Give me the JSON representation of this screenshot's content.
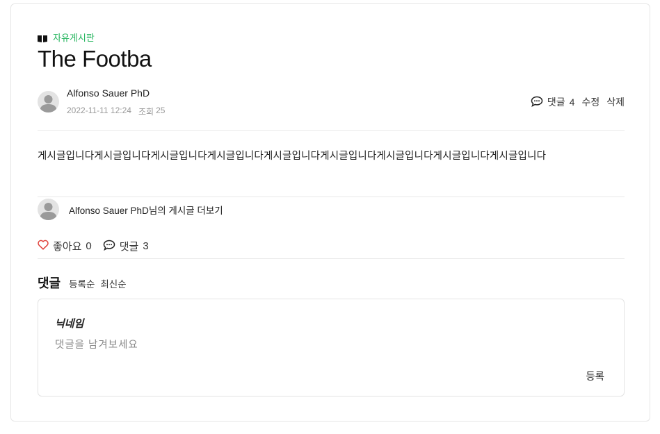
{
  "post": {
    "board": "자유게시판",
    "board_icon": "book-icon",
    "title": "The Footba",
    "author": "Alfonso Sauer PhD",
    "date": "2022-11-11 12:24",
    "views_label": "조회",
    "views": "25",
    "body": "게시글입니다게시글입니다게시글입니다게시글입니다게시글입니다게시글입니다게시글입니다게시글입니다게시글입니다"
  },
  "actions": {
    "comment_label": "댓글",
    "comment_count": "4",
    "edit_label": "수정",
    "delete_label": "삭제"
  },
  "more_posts": {
    "text": "Alfonso Sauer PhD님의 게시글 더보기"
  },
  "reactions": {
    "like_label": "좋아요",
    "like_count": "0",
    "comment_label": "댓글",
    "comment_count": "3"
  },
  "comments": {
    "title": "댓글",
    "sort_options": [
      "등록순",
      "최신순"
    ],
    "form": {
      "nickname": "닉네임",
      "placeholder": "댓글을 남겨보세요",
      "submit_label": "등록"
    }
  },
  "colors": {
    "accent_green": "#1fb35a",
    "like_heart": "#e0413a"
  }
}
